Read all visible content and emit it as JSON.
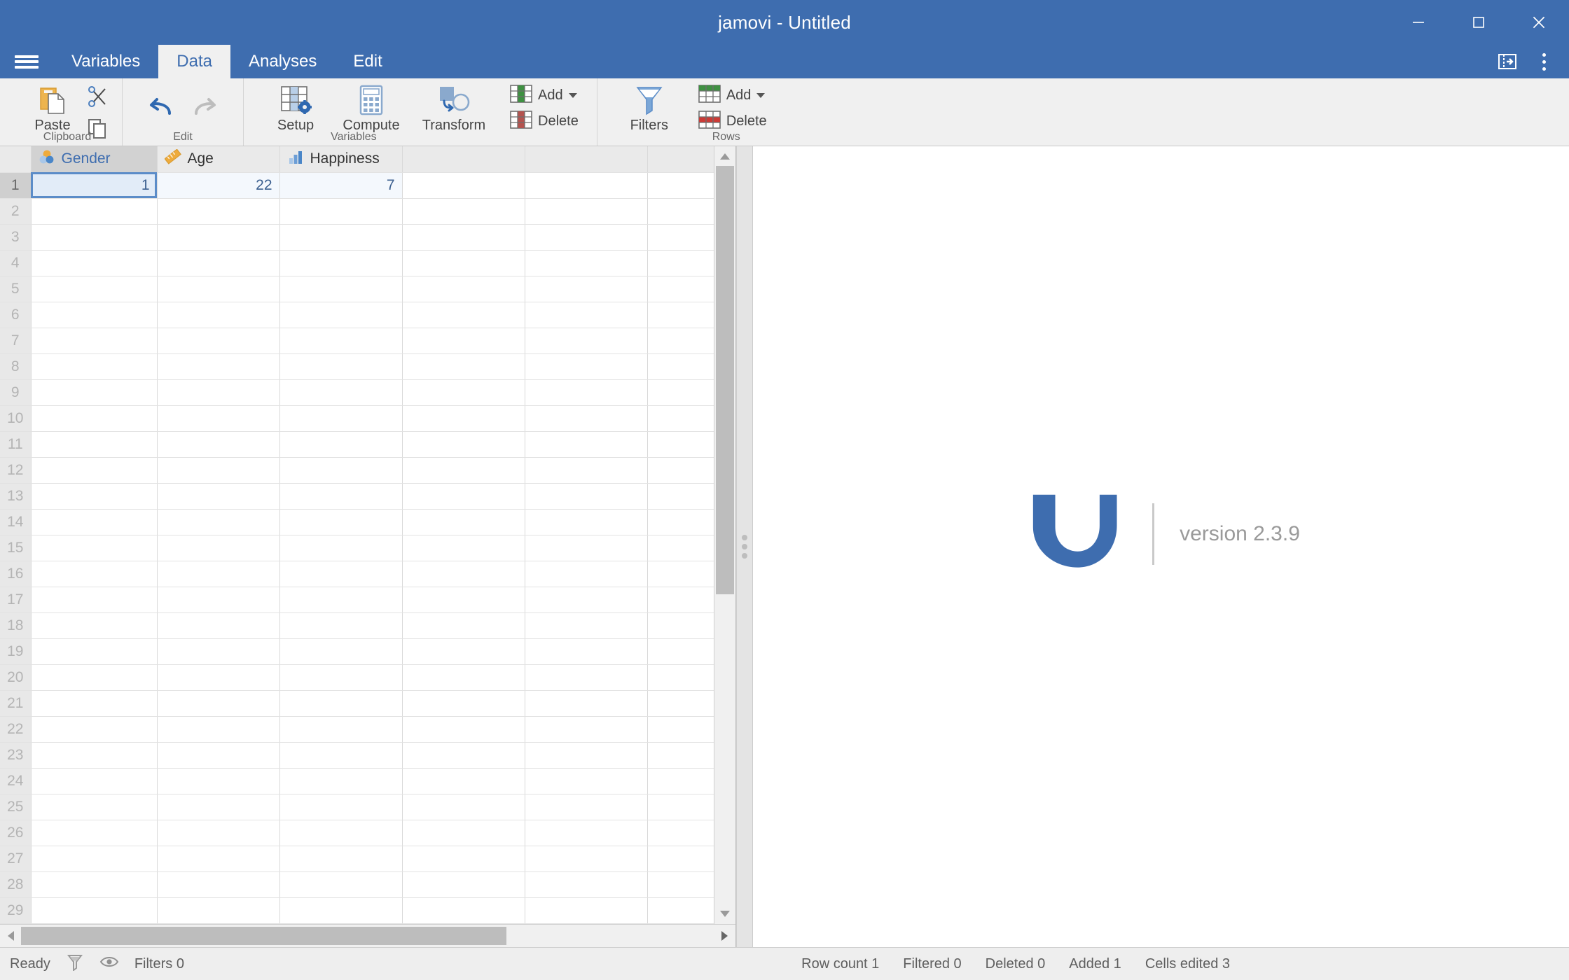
{
  "window": {
    "title": "jamovi - Untitled",
    "minimize_label": "Minimize",
    "maximize_label": "Maximize",
    "close_label": "Close"
  },
  "colors": {
    "titlebar_blue": "#3e6daf",
    "ribbon_bg": "#f0f0f0",
    "accent_blue": "#3e6daf",
    "nominal_orange": "#eeab3c",
    "continuous_orange": "#eeab3c",
    "ordinal_blue": "#5b8cc8",
    "add_green": "#3f9142",
    "delete_red": "#b4534f",
    "cell_text_blue": "#3b5f8f"
  },
  "tabs": {
    "menu_icon": "hamburger-icon",
    "items": [
      {
        "label": "Variables",
        "active": false
      },
      {
        "label": "Data",
        "active": true
      },
      {
        "label": "Analyses",
        "active": false
      },
      {
        "label": "Edit",
        "active": false
      }
    ],
    "right_icons": [
      {
        "name": "toggle-results-panel-icon"
      },
      {
        "name": "overflow-menu-icon"
      }
    ]
  },
  "ribbon": {
    "groups": [
      {
        "label": "Clipboard",
        "big_buttons": [
          {
            "label": "Paste",
            "icon": "paste-icon"
          }
        ],
        "small_buttons": [
          {
            "label": "Cut",
            "icon": "cut-icon",
            "show_label": false
          },
          {
            "label": "Copy",
            "icon": "copy-icon",
            "show_label": false
          }
        ]
      },
      {
        "label": "Edit",
        "big_buttons": [
          {
            "label": "",
            "icon": "undo-icon"
          },
          {
            "label": "",
            "icon": "redo-icon"
          }
        ],
        "small_buttons": []
      },
      {
        "label": "Variables",
        "big_buttons": [
          {
            "label": "Setup",
            "icon": "setup-icon"
          },
          {
            "label": "Compute",
            "icon": "compute-icon"
          },
          {
            "label": "Transform",
            "icon": "transform-icon"
          }
        ],
        "small_buttons": [
          {
            "label": "Add",
            "icon": "add-variable-icon",
            "has_caret": true
          },
          {
            "label": "Delete",
            "icon": "delete-variable-icon",
            "has_caret": false
          }
        ]
      },
      {
        "label": "Rows",
        "big_buttons": [
          {
            "label": "Filters",
            "icon": "filters-funnel-icon"
          }
        ],
        "small_buttons": [
          {
            "label": "Add",
            "icon": "add-row-icon",
            "has_caret": true
          },
          {
            "label": "Delete",
            "icon": "delete-row-icon",
            "has_caret": false
          }
        ]
      }
    ]
  },
  "spreadsheet": {
    "columns": [
      {
        "name": "Gender",
        "measure_icon": "nominal-icon",
        "selected": true
      },
      {
        "name": "Age",
        "measure_icon": "continuous-ruler-icon",
        "selected": false
      },
      {
        "name": "Happiness",
        "measure_icon": "ordinal-bars-icon",
        "selected": false
      },
      {
        "name": "",
        "measure_icon": "",
        "selected": false
      },
      {
        "name": "",
        "measure_icon": "",
        "selected": false
      },
      {
        "name": "",
        "measure_icon": "",
        "selected": false
      }
    ],
    "rows": [
      {
        "number": "1",
        "cells": [
          "1",
          "22",
          "7",
          "",
          "",
          ""
        ]
      },
      {
        "number": "2",
        "cells": [
          "",
          "",
          "",
          "",
          "",
          ""
        ]
      },
      {
        "number": "3",
        "cells": [
          "",
          "",
          "",
          "",
          "",
          ""
        ]
      },
      {
        "number": "4",
        "cells": [
          "",
          "",
          "",
          "",
          "",
          ""
        ]
      },
      {
        "number": "5",
        "cells": [
          "",
          "",
          "",
          "",
          "",
          ""
        ]
      },
      {
        "number": "6",
        "cells": [
          "",
          "",
          "",
          "",
          "",
          ""
        ]
      },
      {
        "number": "7",
        "cells": [
          "",
          "",
          "",
          "",
          "",
          ""
        ]
      },
      {
        "number": "8",
        "cells": [
          "",
          "",
          "",
          "",
          "",
          ""
        ]
      },
      {
        "number": "9",
        "cells": [
          "",
          "",
          "",
          "",
          "",
          ""
        ]
      },
      {
        "number": "10",
        "cells": [
          "",
          "",
          "",
          "",
          "",
          ""
        ]
      },
      {
        "number": "11",
        "cells": [
          "",
          "",
          "",
          "",
          "",
          ""
        ]
      },
      {
        "number": "12",
        "cells": [
          "",
          "",
          "",
          "",
          "",
          ""
        ]
      },
      {
        "number": "13",
        "cells": [
          "",
          "",
          "",
          "",
          "",
          ""
        ]
      },
      {
        "number": "14",
        "cells": [
          "",
          "",
          "",
          "",
          "",
          ""
        ]
      },
      {
        "number": "15",
        "cells": [
          "",
          "",
          "",
          "",
          "",
          ""
        ]
      },
      {
        "number": "16",
        "cells": [
          "",
          "",
          "",
          "",
          "",
          ""
        ]
      },
      {
        "number": "17",
        "cells": [
          "",
          "",
          "",
          "",
          "",
          ""
        ]
      },
      {
        "number": "18",
        "cells": [
          "",
          "",
          "",
          "",
          "",
          ""
        ]
      },
      {
        "number": "19",
        "cells": [
          "",
          "",
          "",
          "",
          "",
          ""
        ]
      },
      {
        "number": "20",
        "cells": [
          "",
          "",
          "",
          "",
          "",
          ""
        ]
      },
      {
        "number": "21",
        "cells": [
          "",
          "",
          "",
          "",
          "",
          ""
        ]
      },
      {
        "number": "22",
        "cells": [
          "",
          "",
          "",
          "",
          "",
          ""
        ]
      },
      {
        "number": "23",
        "cells": [
          "",
          "",
          "",
          "",
          "",
          ""
        ]
      },
      {
        "number": "24",
        "cells": [
          "",
          "",
          "",
          "",
          "",
          ""
        ]
      },
      {
        "number": "25",
        "cells": [
          "",
          "",
          "",
          "",
          "",
          ""
        ]
      },
      {
        "number": "26",
        "cells": [
          "",
          "",
          "",
          "",
          "",
          ""
        ]
      },
      {
        "number": "27",
        "cells": [
          "",
          "",
          "",
          "",
          "",
          ""
        ]
      },
      {
        "number": "28",
        "cells": [
          "",
          "",
          "",
          "",
          "",
          ""
        ]
      },
      {
        "number": "29",
        "cells": [
          "",
          "",
          "",
          "",
          "",
          ""
        ]
      }
    ],
    "selected_cell": {
      "row": 0,
      "col": 0,
      "value": "1"
    }
  },
  "results": {
    "logo_glyph": "ν",
    "version_text": "version 2.3.9"
  },
  "statusbar": {
    "state": "Ready",
    "filter_icon": "funnel-icon",
    "eye_icon": "eye-icon",
    "filters": "Filters 0",
    "row_count": "Row count 1",
    "filtered": "Filtered 0",
    "deleted": "Deleted 0",
    "added": "Added 1",
    "cells_edited": "Cells edited 3"
  }
}
